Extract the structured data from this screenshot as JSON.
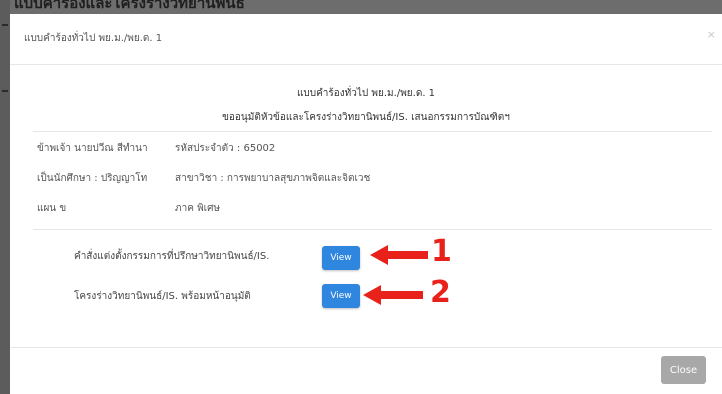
{
  "background": {
    "title": "แบบคำร้องและโครงร่างวิทยานิพนธ์"
  },
  "modal": {
    "title": "แบบคำร้องทั่วไป พย.ม./พย.ด. 1",
    "close_glyph": "×",
    "heading_line1": "แบบคำร้องทั่วไป พย.ม./พย.ด. 1",
    "heading_line2": "ขออนุมัติหัวข้อและโครงร่างวิทยานิพนธ์/IS. เสนอกรรมการบัณฑิตฯ"
  },
  "student_info": {
    "name": "ข้าพเจ้า นายปวีณ สีทำนา",
    "student_id": "รหัสประจำตัว : 65002",
    "degree": "เป็นนักศึกษา : ปริญญาโท",
    "major": "สาขาวิชา : การพยาบาลสุขภาพจิตและจิตเวช",
    "plan": "แผน ข",
    "program": "ภาค พิเศษ"
  },
  "documents": [
    {
      "label": "คำสั่งแต่งตั้งกรรมการที่ปรึกษาวิทยานิพนธ์/IS.",
      "button": "View",
      "annotation": "1"
    },
    {
      "label": "โครงร่างวิทยานิพนธ์/IS. พร้อมหน้าอนุมัติ",
      "button": "View",
      "annotation": "2"
    }
  ],
  "footer": {
    "close_label": "Close"
  },
  "colors": {
    "primary_button": "#2e86de",
    "annotation_red": "#e8221b",
    "close_button": "#a8a8a8"
  }
}
